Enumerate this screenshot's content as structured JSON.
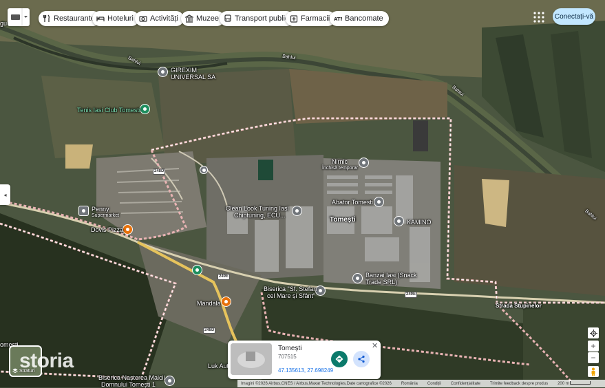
{
  "colors": {
    "boundary": "#e8b3b3",
    "pin_gray": "#70757a",
    "pin_green": "#1e8e5e",
    "pin_orange": "#e8710a",
    "road_yellow": "#e6c35c",
    "accent_blue": "#1a73e8"
  },
  "chips": [
    {
      "label": "Restaurante",
      "icon": "fork-knife-icon"
    },
    {
      "label": "Hoteluri",
      "icon": "bed-icon"
    },
    {
      "label": "Activități",
      "icon": "camera-icon"
    },
    {
      "label": "Muzee",
      "icon": "museum-icon"
    },
    {
      "label": "Transport public",
      "icon": "bus-icon"
    },
    {
      "label": "Farmacii",
      "icon": "pharmacy-icon"
    },
    {
      "label": "Bancomate",
      "icon": "atm-icon"
    }
  ],
  "header": {
    "signin_label": "Conectați-vă"
  },
  "map_labels": {
    "top_left_cut": "gu",
    "bahlui_1": "Bahlui",
    "bahlui_2": "Bahlui",
    "bahlui_3": "Bahlui",
    "bahlui_4": "Bahlui",
    "girexim_1": "GIREXIM",
    "girexim_2": "UNIVERSAL SA",
    "tenis": "Tenis Iasi Club Tomesti",
    "nirnic_1": "Nirnic",
    "nirnic_2": "Închisă temporar",
    "penny_1": "Penny",
    "penny_2": "Supermarket",
    "dovis": "Dovis Pizza",
    "clean_1": "Clean Look Tuning Iasi",
    "clean_2": "Chiptuning, ECU...",
    "abator": "Abator Tomesti",
    "tomesti": "Tomești",
    "kamino": "KAMINO",
    "banzai_1": "Banzai Iasi (Snack",
    "banzai_2": "Trade SRL)",
    "biserica_1": "Biserica \"Sf. Stefan",
    "biserica_2": "cel Mare și Sfânt\"",
    "mandala": "Mandala",
    "strada": "Strada Stupinelor",
    "tomesti_left": "omesti",
    "luk": "Luk Aut",
    "biserica2_1": "Biserica Nașterea Maicii",
    "biserica2_2": "Domnului Tomești 1"
  },
  "road_shields": [
    "248D",
    "249E",
    "249E",
    "248D"
  ],
  "info_card": {
    "title": "Tomești",
    "postal_code": "707515",
    "coordinates": "47.135613, 27.698249"
  },
  "watermark": "storia",
  "layers_label": "Straturi",
  "footer": {
    "imagery": "Imagini ©2026 Airbus,CNES / Airbus,Maxar Technologies,Date cartografice ©2026",
    "country": "România",
    "terms": "Condiții",
    "privacy": "Confidențialitate",
    "feedback": "Trimite feedback despre produs",
    "scale": "200 m"
  }
}
